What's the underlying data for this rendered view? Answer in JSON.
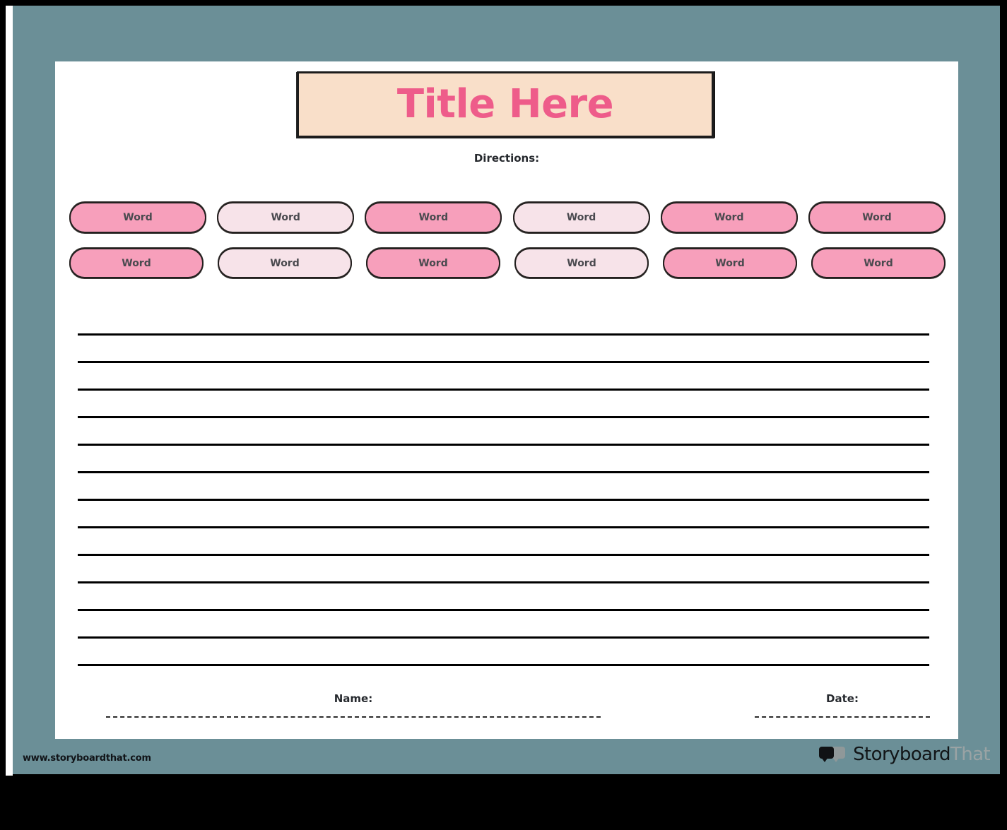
{
  "worksheet": {
    "title": "Title Here",
    "directions_label": "Directions:",
    "title_color": "#EE5C8A",
    "title_box_color": "#F9DFC9",
    "canvas_color": "#6B8F97"
  },
  "word_bank": {
    "rows": [
      [
        {
          "label": "Word",
          "fill": "dark"
        },
        {
          "label": "Word",
          "fill": "light"
        },
        {
          "label": "Word",
          "fill": "dark"
        },
        {
          "label": "Word",
          "fill": "light"
        },
        {
          "label": "Word",
          "fill": "dark"
        },
        {
          "label": "Word",
          "fill": "dark"
        }
      ],
      [
        {
          "label": "Word",
          "fill": "dark"
        },
        {
          "label": "Word",
          "fill": "light"
        },
        {
          "label": "Word",
          "fill": "dark"
        },
        {
          "label": "Word",
          "fill": "light"
        },
        {
          "label": "Word",
          "fill": "dark"
        },
        {
          "label": "Word",
          "fill": "dark"
        }
      ]
    ],
    "pill_dark_color": "#F79FBB",
    "pill_light_color": "#F7E3E9"
  },
  "writing_area": {
    "line_count": 13
  },
  "footer": {
    "name_label": "Name:",
    "date_label": "Date:"
  },
  "branding": {
    "url": "www.storyboardthat.com",
    "logo_primary": "Storyboard",
    "logo_secondary": "That"
  }
}
